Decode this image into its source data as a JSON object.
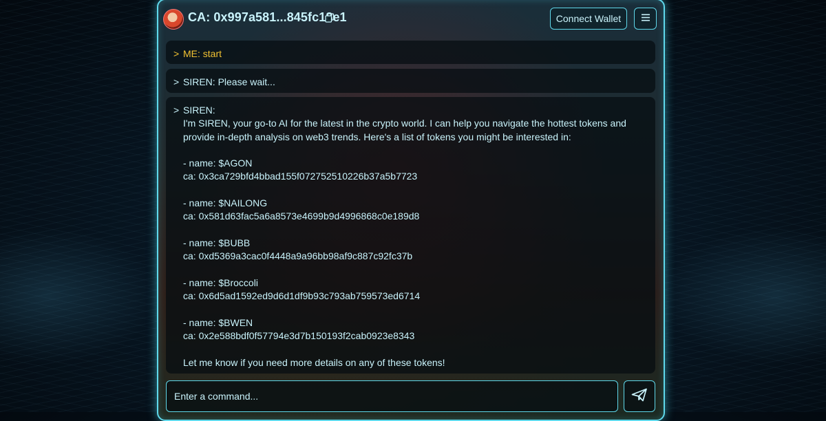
{
  "header": {
    "ca_text": "CA: 0x997a581...845fc18e1",
    "connect_wallet_label": "Connect Wallet"
  },
  "messages": [
    {
      "prompt": ">",
      "text": "ME: start"
    },
    {
      "prompt": ">",
      "text": "SIREN: Please wait..."
    },
    {
      "prompt": ">",
      "speaker": "SIREN:",
      "text": "I'm SIREN, your go-to AI for the latest in the crypto world. I can help you navigate the hottest tokens and provide in-depth analysis on web3 trends. Here's a list of tokens you might be interested in:\n\n- name: $AGON\nca: 0x3ca729bfd4bbad155f072752510226b37a5b7723\n\n- name: $NAILONG\nca: 0x581d63fac5a6a8573e4699b9d4996868c0e189d8\n\n- name: $BUBB\nca: 0xd5369a3cac0f4448a9a96bb98af9c887c92fc37b\n\n- name: $Broccoli\nca: 0x6d5ad1592ed9d6d1df9b93c793ab759573ed6714\n\n- name: $BWEN\nca: 0x2e588bdf0f57794e3d7b150193f2cab0923e8343\n\nLet me know if you need more details on any of these tokens!"
    }
  ],
  "input": {
    "placeholder": "Enter a command..."
  },
  "icons": {
    "copy": "copy-icon",
    "menu": "hamburger-menu-icon",
    "send": "send-paper-plane-icon"
  },
  "colors": {
    "accent": "#5fd9ec",
    "text": "#c9f3fb",
    "user_message": "#f2c232"
  }
}
